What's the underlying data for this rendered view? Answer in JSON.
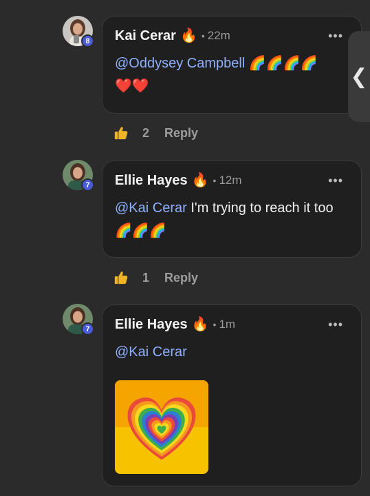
{
  "comments": [
    {
      "author": "Kai Cerar",
      "fire": "🔥",
      "dot": "•",
      "time": "22m",
      "level": "8",
      "mention": "@Oddysey Campbell",
      "text": "",
      "emojis_line1": "🌈🌈🌈🌈",
      "emojis_line2": "❤️❤️",
      "likes": "2",
      "reply_label": "Reply",
      "more_label": "•••"
    },
    {
      "author": "Ellie Hayes",
      "fire": "🔥",
      "dot": "•",
      "time": "12m",
      "level": "7",
      "mention": "@Kai Cerar",
      "text": " I'm trying to reach it too ",
      "emojis_line1": "🌈🌈🌈",
      "likes": "1",
      "reply_label": "Reply",
      "more_label": "•••"
    },
    {
      "author": "Ellie Hayes",
      "fire": "🔥",
      "dot": "•",
      "time": "1m",
      "level": "7",
      "mention": "@Kai Cerar",
      "more_label": "•••"
    }
  ],
  "side_tab": {
    "glyph": "❮"
  },
  "icons": {
    "like": "thumbs-up-icon",
    "sticker": "rainbow-heart-sticker"
  },
  "colors": {
    "mention": "#8fb0ff",
    "badge": "#4a5bd6",
    "bubble": "#1f1f1f"
  }
}
